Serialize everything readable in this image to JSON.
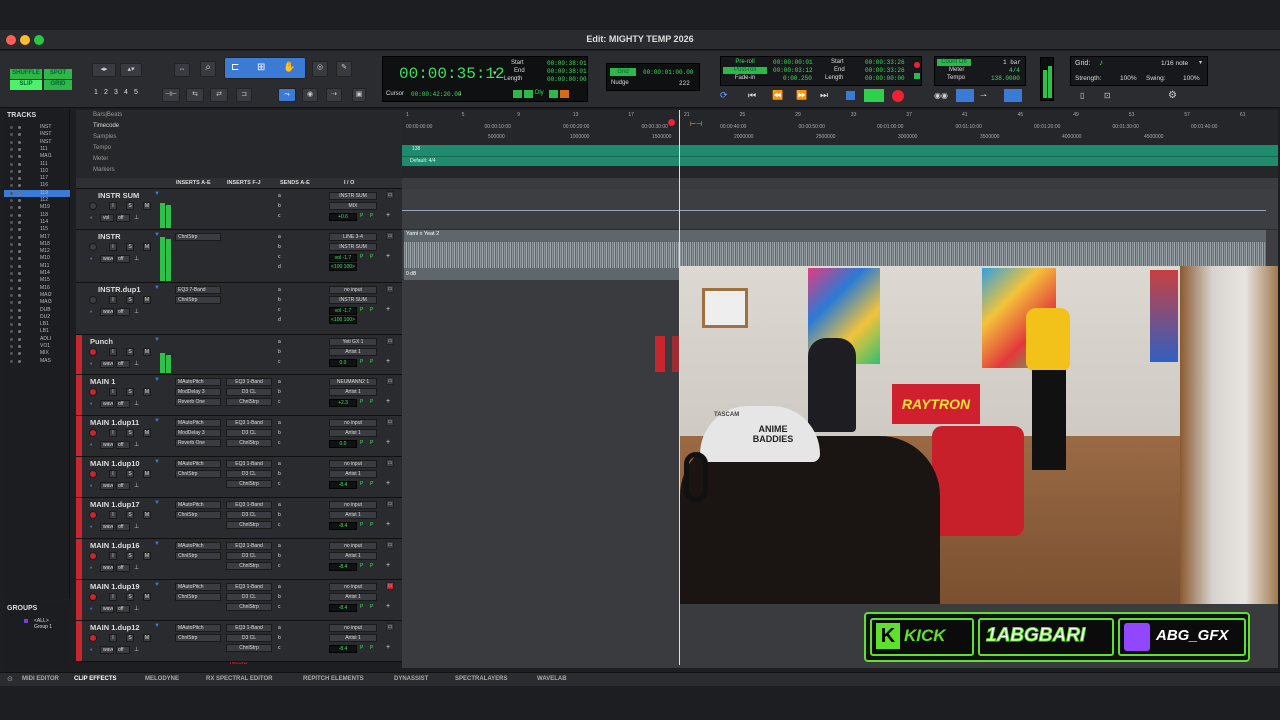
{
  "window": {
    "title": "Edit: MIGHTY TEMP 2026"
  },
  "modes": {
    "shuffle": "SHUFFLE",
    "spot": "SPOT",
    "slip": "SLIP",
    "grid": "GRID"
  },
  "zoom_presets": [
    "1",
    "2",
    "3",
    "4",
    "5"
  ],
  "main_counter": {
    "time": "00:00:35:12",
    "start_label": "Start",
    "end_label": "End",
    "length_label": "Length",
    "start": "00:00:38:01",
    "end": "00:00:38:01",
    "length": "00:00:00:00",
    "cursor_label": "Cursor",
    "cursor": "00:00:42:20.00",
    "dly": "Dly"
  },
  "grid_nudge": {
    "grid_label": "Grid",
    "grid_value": "00:00:01:00.00",
    "nudge_label": "Nudge",
    "nudge_value": "222"
  },
  "pre_post": {
    "preroll_label": "Pre-roll",
    "postroll_label": "Post-roll",
    "fadein_label": "Fade-in",
    "preroll": "00:00:00:01",
    "postroll": "00:00:03:12",
    "fadein": "0:00.250",
    "start_label": "Start",
    "end_label": "End",
    "length_label": "Length",
    "start": "00:00:33:26",
    "end": "00:00:33:26",
    "length": "00:00:00:00"
  },
  "countoff": {
    "countoff_label": "Count Off",
    "meter_label": "Meter",
    "tempo_label": "Tempo",
    "countoff_value": "1 bar",
    "meter_value": "4/4",
    "tempo_value": "138.0000"
  },
  "midi_grid": {
    "grid_label": "Grid:",
    "grid_value": "1/16 note",
    "strength_label": "Strength:",
    "strength_value": "100%",
    "swing_label": "Swing:",
    "swing_value": "100%"
  },
  "tracks_panel": {
    "title": "TRACKS",
    "items": [
      "INST",
      "INST",
      "INST",
      "111",
      "MAI1",
      "111",
      "110",
      "117",
      "116",
      "119",
      "112",
      "M19",
      "118",
      "114",
      "115",
      "M17",
      "M18",
      "M12",
      "M10",
      "M11",
      "M14",
      "M15",
      "M16",
      "MAI2",
      "MAI3",
      "DUB",
      "DU2",
      "LB1",
      "LB1",
      "ADLI",
      "VO1",
      "MIX",
      "MAS"
    ]
  },
  "groups_panel": {
    "title": "GROUPS",
    "items": [
      "<ALL>",
      "Group 1"
    ]
  },
  "ruler_labels": [
    "Bars|Beats",
    "Timecode",
    "Samples",
    "Tempo",
    "Meter",
    "Markers"
  ],
  "columns": {
    "inserts_ae": "INSERTS A-E",
    "inserts_fj": "INSERTS F-J",
    "sends_ae": "SENDS A-E",
    "io": "I / O"
  },
  "tracks": [
    {
      "name": "INSTR SUM",
      "inserts1": [],
      "inserts2": [],
      "io": [
        "INSTR SUM",
        "MIX"
      ],
      "vol": "+0.6",
      "mode": "vol",
      "record": false,
      "meter": 0.7,
      "sends": [
        "a",
        "b",
        "c"
      ]
    },
    {
      "name": "INSTR",
      "inserts1": [
        "ChnlStrp"
      ],
      "inserts2": [],
      "io": [
        "LINE 3-4",
        "INSTR SUM"
      ],
      "vol": "vol    -1.7",
      "pan": "<100   100>",
      "mode": "wave",
      "record": false,
      "meter": 0.9,
      "sends": [
        "a",
        "b",
        "c",
        "d"
      ]
    },
    {
      "name": "INSTR.dup1",
      "inserts1": [
        "EQ3 7-Band",
        "ChnlStrp"
      ],
      "inserts2": [],
      "io": [
        "no input",
        "INSTR SUM"
      ],
      "vol": "vol    -1.7",
      "pan": "<100   100>",
      "mode": "wave",
      "record": false,
      "meter": 0,
      "sends": [
        "a",
        "b",
        "c",
        "d"
      ]
    },
    {
      "name": "Punch",
      "inserts1": [],
      "inserts2": [],
      "io": [
        "Yeti GX 1",
        "Artist 1"
      ],
      "vol": "0.0",
      "mode": "wave",
      "record": true,
      "meter": 0.6,
      "sends": [
        "a",
        "b",
        "c"
      ]
    },
    {
      "name": "MAIN 1",
      "inserts1": [
        "MAutoPitch",
        "ModDelay 3",
        "Reverb One"
      ],
      "inserts2": [
        "EQ3 1-Band",
        "D3 CL",
        "ChnlStrp"
      ],
      "io": [
        "NEUMANN2 1",
        "Artist 1"
      ],
      "vol": "+2.3",
      "mode": "wave",
      "record": true,
      "meter": 0,
      "sends": [
        "a",
        "b",
        "c"
      ]
    },
    {
      "name": "MAIN 1.dup11",
      "inserts1": [
        "MAutoPitch",
        "ModDelay 3",
        "Reverb One"
      ],
      "inserts2": [
        "EQ3 1-Band",
        "D3 CL",
        "ChnlStrp"
      ],
      "io": [
        "no input",
        "Artist 1"
      ],
      "vol": "0.0",
      "mode": "wave",
      "record": true,
      "meter": 0,
      "sends": [
        "a",
        "b",
        "c"
      ]
    },
    {
      "name": "MAIN 1.dup10",
      "inserts1": [
        "MAutoPitch",
        "ChnlStrp"
      ],
      "inserts2": [
        "EQ3 1-Band",
        "D3 CL",
        "ChnlStrp"
      ],
      "io": [
        "no input",
        "Artist 1"
      ],
      "vol": "-8.4",
      "mode": "wave",
      "record": true,
      "meter": 0,
      "sends": [
        "a",
        "b",
        "c"
      ]
    },
    {
      "name": "MAIN 1.dup17",
      "inserts1": [
        "MAutoPitch",
        "ChnlStrp"
      ],
      "inserts2": [
        "EQ3 1-Band",
        "D3 CL",
        "ChnlStrp"
      ],
      "io": [
        "no input",
        "Artist 1"
      ],
      "vol": "-8.4",
      "mode": "wave",
      "record": true,
      "meter": 0,
      "sends": [
        "a",
        "b",
        "c"
      ]
    },
    {
      "name": "MAIN 1.dup16",
      "inserts1": [
        "MAutoPitch",
        "ChnlStrp"
      ],
      "inserts2": [
        "EQ3 1-Band",
        "D3 CL",
        "ChnlStrp"
      ],
      "io": [
        "no input",
        "Artist 1"
      ],
      "vol": "-8.4",
      "mode": "wave",
      "record": true,
      "meter": 0,
      "sends": [
        "a",
        "b",
        "c"
      ]
    },
    {
      "name": "MAIN 1.dup19",
      "inserts1": [
        "MAutoPitch",
        "ChnlStrp"
      ],
      "inserts2": [
        "EQ3 1-Band",
        "D3 CL",
        "ChnlStrp"
      ],
      "io": [
        "no input",
        "Artist 1"
      ],
      "vol": "-8.4",
      "mode": "wave",
      "record": true,
      "meter": 0,
      "sends": [
        "a",
        "b",
        "c"
      ]
    },
    {
      "name": "MAIN 1.dup12",
      "inserts1": [
        "MAutoPitch",
        "ChnlStrp"
      ],
      "inserts2": [
        "EQ3 1-Band",
        "D3 CL",
        "ChnlStrp"
      ],
      "io": [
        "no input",
        "Artist 1"
      ],
      "vol": "-8.4",
      "mode": "wave",
      "record": true,
      "meter": 0,
      "sends": [
        "a",
        "b",
        "c"
      ]
    }
  ],
  "record_label": "record",
  "bar_ticks": [
    "1",
    "5",
    "9",
    "13",
    "17",
    "21",
    "25",
    "29",
    "33",
    "37",
    "41",
    "45",
    "49",
    "53",
    "57",
    "61"
  ],
  "timecode_ticks": [
    "00:00:00:00",
    "00:00:10:00",
    "00:00:20:00",
    "00:00:30:00",
    "00:00:40:00",
    "00:00:50:00",
    "00:01:00:00",
    "00:01:10:00",
    "00:01:20:00",
    "00:01:30:00",
    "00:01:40:00"
  ],
  "sample_ticks": [
    "500000",
    "1000000",
    "1500000",
    "2000000",
    "2500000",
    "3000000",
    "3500000",
    "4000000",
    "4500000"
  ],
  "tempo_marker": "138",
  "meter_marker": "Default: 4/4",
  "clip_name": "Yami x Yeat 2",
  "clip_gain": "0 dB",
  "bottom_tabs": [
    "MIDI EDITOR",
    "CLIP EFFECTS",
    "MELODYNE",
    "RX SPECTRAL EDITOR",
    "REPITCH ELEMENTS",
    "DYNASSIST",
    "SPECTRALAYERS",
    "WAVELAB"
  ],
  "webcam": {
    "poster_text": "RAYTRON",
    "cap_text": "ANIME BADDIES",
    "cap_brand": "TASCAM"
  },
  "banner": {
    "kick_label": "KICK",
    "kick_user": "1ABGBARI",
    "twitch_user": "ABG_GFX"
  }
}
